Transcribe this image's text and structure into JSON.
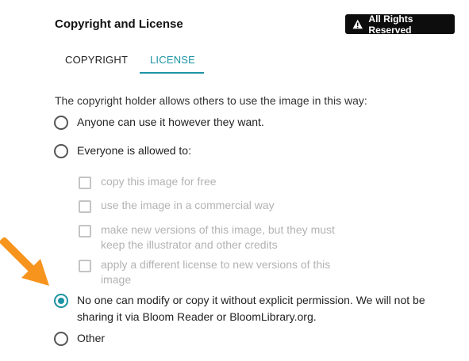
{
  "header": {
    "title": "Copyright and License",
    "badge_label": "All Rights Reserved",
    "badge_icon": "warning-triangle-icon"
  },
  "tabs": [
    {
      "label": "COPYRIGHT",
      "selected": false
    },
    {
      "label": "LICENSE",
      "selected": true
    }
  ],
  "license": {
    "intro": "The copyright holder allows others to use the image in this way:",
    "option_anyone": "Anyone can use it however they want.",
    "option_everyone": "Everyone is allowed to:",
    "permissions": {
      "copy_free": "copy this image for free",
      "commercial": "use the image in a commercial way",
      "new_versions_line1": "make new versions of this image, but they must",
      "new_versions_line2": "keep the illustrator and other credits",
      "different_license_line1": "apply a different license to new versions of this",
      "different_license_line2": "image"
    },
    "option_no_one_line1": "No one can modify or copy it without explicit permission. We will not be",
    "option_no_one_line2": "sharing it via Bloom Reader or BloomLibrary.org.",
    "option_other": "Other",
    "selected_option": "no_one"
  },
  "colors": {
    "accent": "#1d94a4",
    "annotation_arrow": "#f7941d",
    "badge_bg": "#0d0d0d",
    "disabled_text": "#b3b3b3"
  }
}
